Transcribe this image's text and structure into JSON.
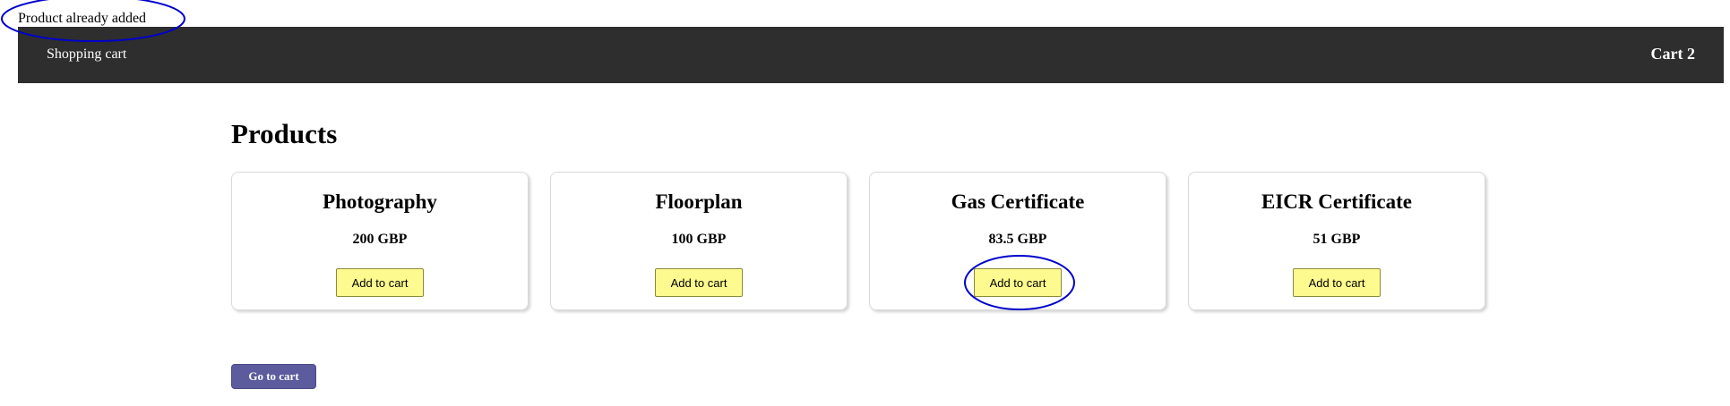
{
  "notice": "Product already added",
  "header": {
    "brand": "Shopping cart",
    "cart_label": "Cart 2"
  },
  "page_title": "Products",
  "products": [
    {
      "name": "Photography",
      "price": "200 GBP",
      "button": "Add to cart"
    },
    {
      "name": "Floorplan",
      "price": "100 GBP",
      "button": "Add to cart"
    },
    {
      "name": "Gas Certificate",
      "price": "83.5 GBP",
      "button": "Add to cart"
    },
    {
      "name": "EICR Certificate",
      "price": "51 GBP",
      "button": "Add to cart"
    }
  ],
  "go_to_cart": "Go to cart",
  "colors": {
    "header_bg": "#2e2e2e",
    "add_button_bg": "#fdfb8f",
    "go_button_bg": "#5b5b9e",
    "annotation": "#0000cc"
  }
}
